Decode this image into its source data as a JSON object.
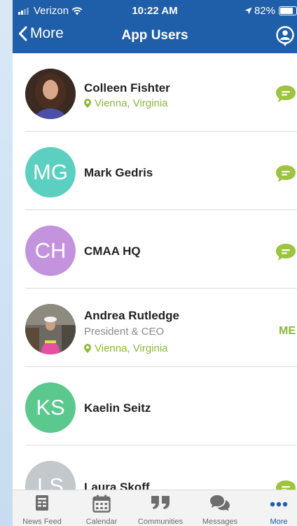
{
  "status_bar": {
    "carrier": "Verizon",
    "time": "10:22 AM",
    "battery": "82%"
  },
  "nav": {
    "back_label": "More",
    "title": "App Users"
  },
  "colors": {
    "header": "#1f5ea8",
    "accent_green": "#8ab83c",
    "chat_icon": "#9cc43e"
  },
  "users": [
    {
      "name": "Colleen Fishter",
      "subtitle": "",
      "location": "Vienna, Virginia",
      "initials": "",
      "avatar_color": "#6b4a3d",
      "action": "message"
    },
    {
      "name": "Mark Gedris",
      "subtitle": "",
      "location": "",
      "initials": "MG",
      "avatar_color": "#5cd0c0",
      "action": "message"
    },
    {
      "name": "CMAA HQ",
      "subtitle": "",
      "location": "",
      "initials": "CH",
      "avatar_color": "#c493dd",
      "action": "message"
    },
    {
      "name": "Andrea Rutledge",
      "subtitle": "President & CEO",
      "location": "Vienna, Virginia",
      "initials": "",
      "avatar_color": "#7a6650",
      "action": "ME"
    },
    {
      "name": "Kaelin Seitz",
      "subtitle": "",
      "location": "",
      "initials": "KS",
      "avatar_color": "#5bc88d",
      "action": ""
    },
    {
      "name": "Laura Skoff",
      "subtitle": "",
      "location": "",
      "initials": "LS",
      "avatar_color": "#c3c8cc",
      "action": "message"
    }
  ],
  "tabs": [
    {
      "label": "News Feed",
      "icon": "news-feed-icon"
    },
    {
      "label": "Calendar",
      "icon": "calendar-icon"
    },
    {
      "label": "Communities",
      "icon": "quote-icon"
    },
    {
      "label": "Messages",
      "icon": "chat-bubbles-icon"
    },
    {
      "label": "More",
      "icon": "more-dots-icon",
      "active": true
    }
  ]
}
